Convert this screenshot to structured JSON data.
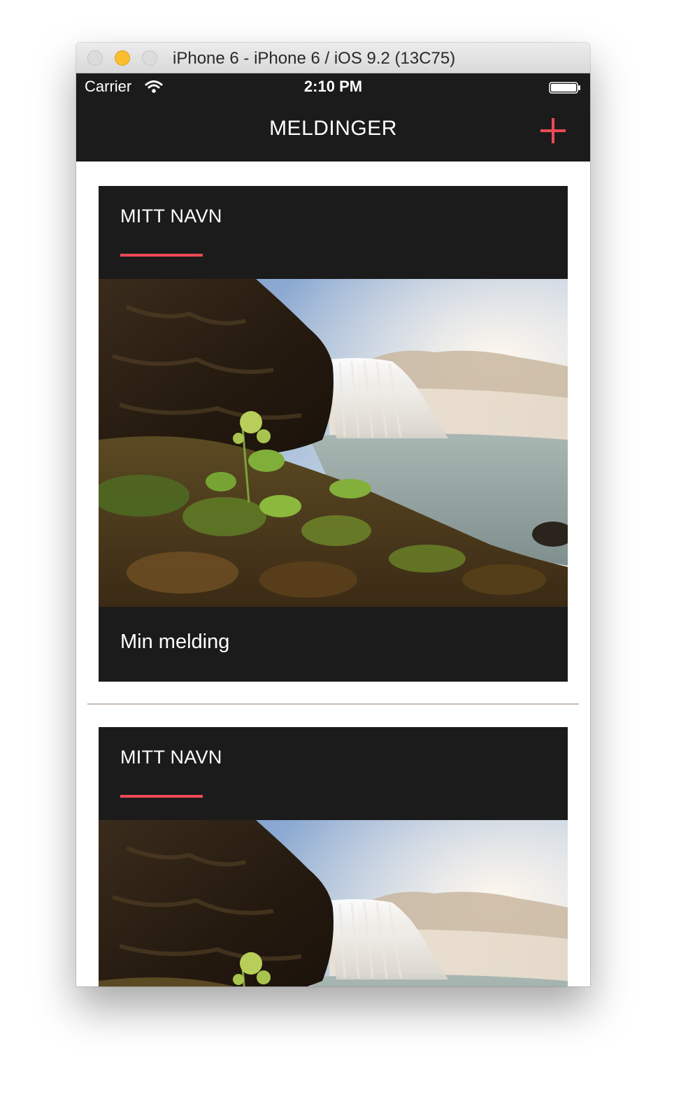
{
  "window": {
    "title": "iPhone 6 - iPhone 6 / iOS 9.2 (13C75)"
  },
  "status_bar": {
    "carrier": "Carrier",
    "time": "2:10 PM",
    "icons": [
      "wifi-icon",
      "battery-icon"
    ]
  },
  "nav": {
    "title": "MELDINGER",
    "add_icon": "plus-icon"
  },
  "colors": {
    "bar_background": "#1b1b1c",
    "accent": "#ef4a55",
    "divider": "#c8bcb4"
  },
  "messages": [
    {
      "name": "MITT NAVN",
      "image": "waterfall-landscape-photo",
      "text": "Min melding"
    },
    {
      "name": "MITT NAVN",
      "image": "waterfall-landscape-photo"
    }
  ]
}
